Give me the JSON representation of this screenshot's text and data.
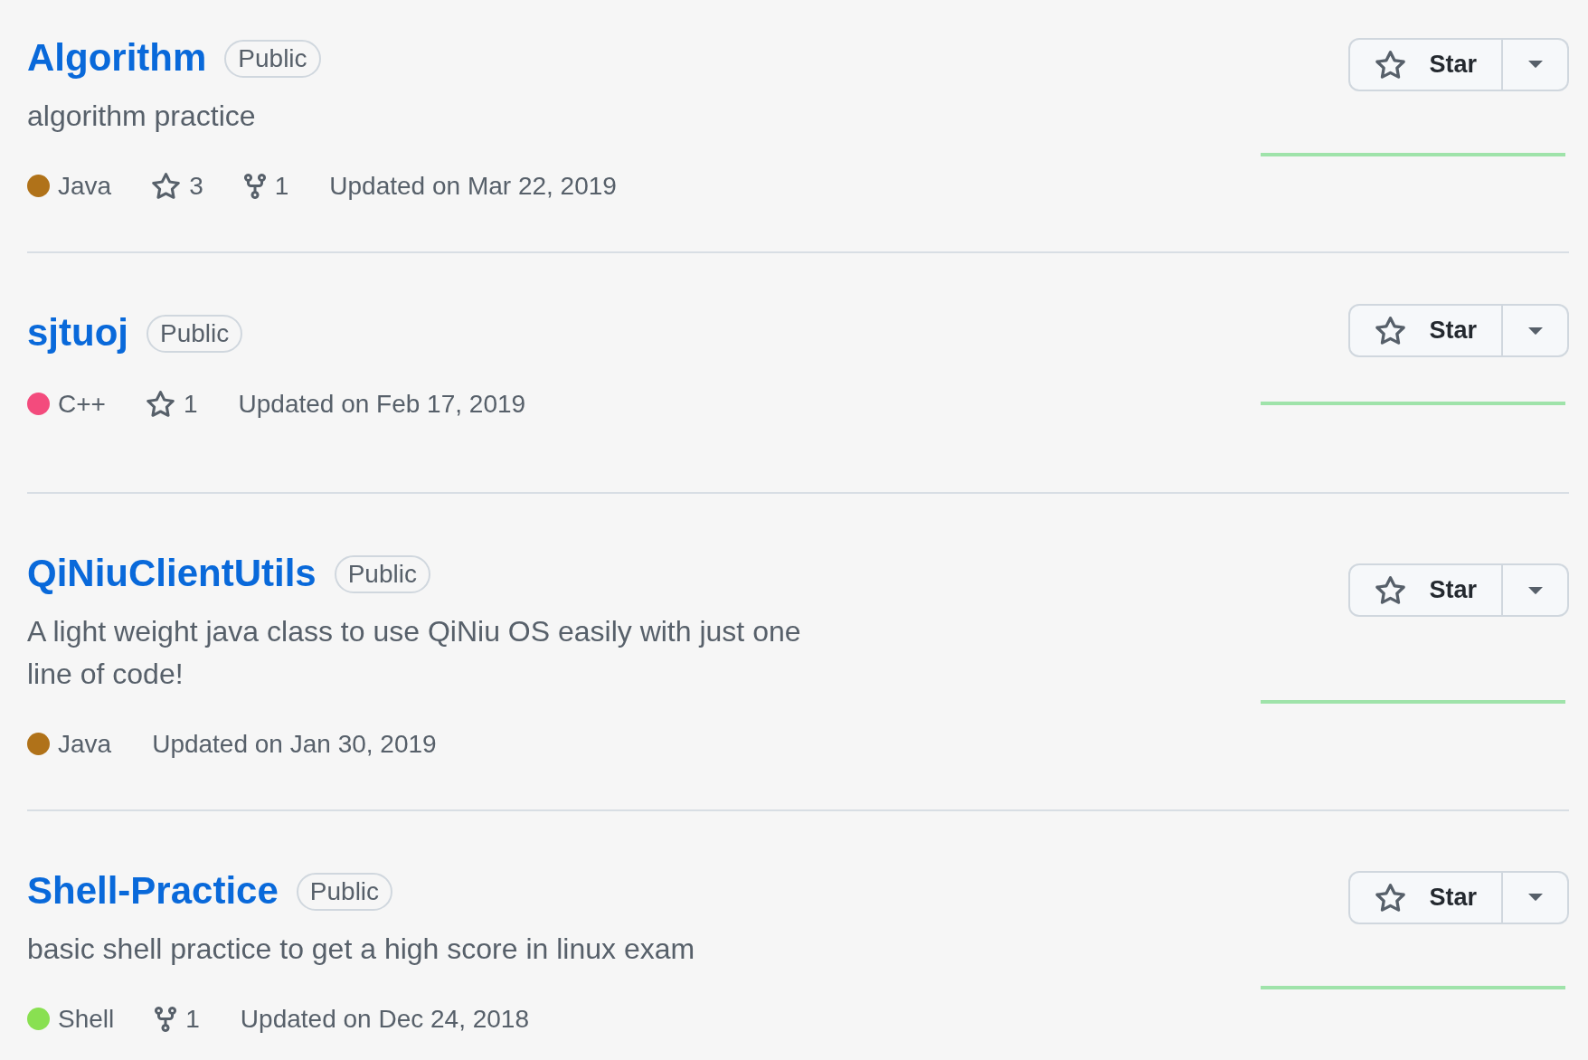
{
  "repositories": [
    {
      "name": "Algorithm",
      "visibility": "Public",
      "description": "algorithm practice",
      "language": {
        "name": "Java",
        "color": "#b07219"
      },
      "stargazers": "3",
      "forks": "1",
      "updated": "Updated on Mar 22, 2019",
      "star_button": "Star"
    },
    {
      "name": "sjtuoj",
      "visibility": "Public",
      "language": {
        "name": "C++",
        "color": "#f34b7d"
      },
      "stargazers": "1",
      "updated": "Updated on Feb 17, 2019",
      "star_button": "Star"
    },
    {
      "name": "QiNiuClientUtils",
      "visibility": "Public",
      "description": "A light weight java class to use QiNiu OS easily with just one line of code!",
      "language": {
        "name": "Java",
        "color": "#b07219"
      },
      "updated": "Updated on Jan 30, 2019",
      "star_button": "Star"
    },
    {
      "name": "Shell-Practice",
      "visibility": "Public",
      "description": "basic shell practice to get a high score in linux exam",
      "language": {
        "name": "Shell",
        "color": "#89e051"
      },
      "forks": "1",
      "updated": "Updated on Dec 24, 2018",
      "star_button": "Star"
    }
  ]
}
